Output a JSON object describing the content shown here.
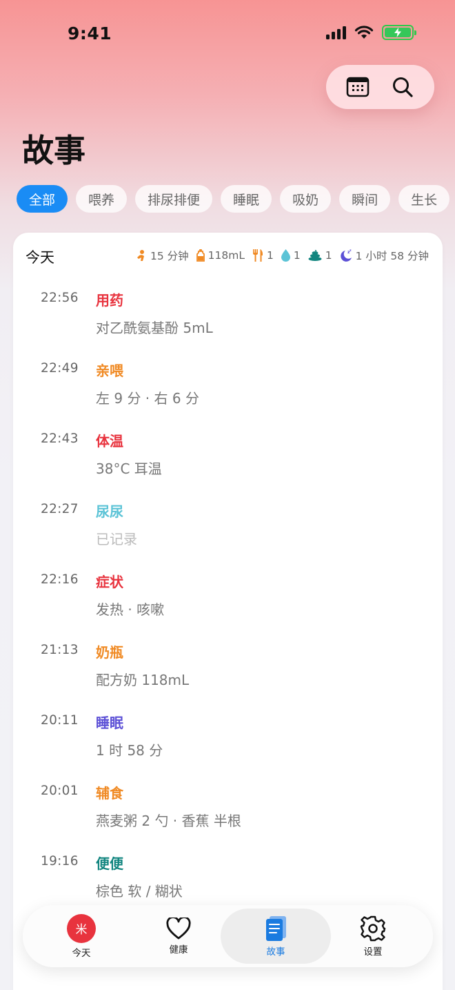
{
  "status_bar": {
    "time": "9:41"
  },
  "header": {
    "title": "故事"
  },
  "filters": [
    {
      "label": "全部",
      "active": true
    },
    {
      "label": "喂养"
    },
    {
      "label": "排尿排便"
    },
    {
      "label": "睡眠"
    },
    {
      "label": "吸奶"
    },
    {
      "label": "瞬间"
    },
    {
      "label": "生长"
    }
  ],
  "summary": {
    "day_label": "今天",
    "pump": "15 分钟",
    "bottle": "118mL",
    "solids": "1",
    "pee": "1",
    "poop": "1",
    "sleep": "1 小时 58 分钟"
  },
  "entries": [
    {
      "time": "22:56",
      "type": "用药",
      "detail": "对乙酰氨基酚 5mL",
      "color": "#e8333e"
    },
    {
      "time": "22:49",
      "type": "亲喂",
      "detail": "左 9 分 · 右 6 分",
      "color": "#f08a24"
    },
    {
      "time": "22:43",
      "type": "体温",
      "detail": "38°C 耳温",
      "color": "#e8333e"
    },
    {
      "time": "22:27",
      "type": "尿尿",
      "detail": "已记录",
      "color": "#5bc3d6",
      "muted": true
    },
    {
      "time": "22:16",
      "type": "症状",
      "detail": "发热 · 咳嗽",
      "color": "#e8333e"
    },
    {
      "time": "21:13",
      "type": "奶瓶",
      "detail": "配方奶 118mL",
      "color": "#f08a24"
    },
    {
      "time": "20:11",
      "type": "睡眠",
      "detail": "1 时 58 分",
      "color": "#5b4fd6"
    },
    {
      "time": "20:01",
      "type": "辅食",
      "detail": "燕麦粥 2 勺 · 香蕉 半根",
      "color": "#f08a24"
    },
    {
      "time": "19:16",
      "type": "便便",
      "detail": "棕色 软 / 糊状",
      "color": "#11857f"
    }
  ],
  "tabbar": {
    "today": {
      "label": "今天",
      "avatar": "米"
    },
    "health": {
      "label": "健康"
    },
    "stories": {
      "label": "故事"
    },
    "settings": {
      "label": "设置"
    }
  },
  "colors": {
    "accent": "#1a8cf5",
    "stories_tab": "#1a7be0",
    "battery": "#35c759",
    "pump_icon": "#f08a24",
    "pee_icon": "#5bc3d6",
    "poop_icon": "#11857f",
    "sleep_icon": "#5b4fd6"
  }
}
